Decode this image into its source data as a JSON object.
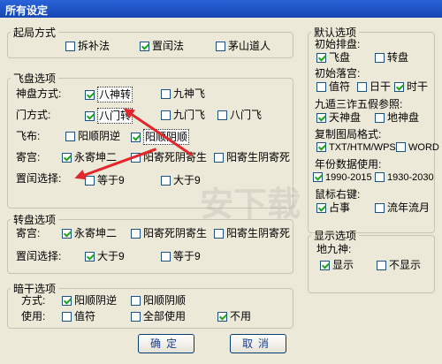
{
  "window": {
    "title": "所有设定"
  },
  "qiju": {
    "legend": "起局方式",
    "opts": [
      "拆补法",
      "置闰法",
      "茅山道人"
    ],
    "checked": [
      false,
      true,
      false
    ]
  },
  "feipan": {
    "legend": "飞盘选项",
    "shenpan": {
      "label": "神盘方式:",
      "opts": [
        "八神转",
        "九神飞"
      ],
      "checked": [
        true,
        false
      ]
    },
    "men": {
      "label": "门方式:",
      "opts": [
        "八门转",
        "九门飞",
        "八门飞"
      ],
      "checked": [
        true,
        false,
        false
      ]
    },
    "feibu": {
      "label": "飞布:",
      "opts": [
        "阳顺阴逆",
        "阳顺阴顺"
      ],
      "checked": [
        false,
        true
      ]
    },
    "jigong": {
      "label": "寄宫:",
      "opts": [
        "永寄坤二",
        "阳寄死阴寄生",
        "阳寄生阴寄死"
      ],
      "checked": [
        true,
        false,
        false
      ]
    },
    "zhirun": {
      "label": "置闰选择:",
      "opts": [
        "等于9",
        "大于9"
      ],
      "checked": [
        false,
        false
      ]
    }
  },
  "zhuanpan": {
    "legend": "转盘选项",
    "jigong": {
      "label": "寄宫:",
      "opts": [
        "永寄坤二",
        "阳寄死阴寄生",
        "阳寄生阴寄死"
      ],
      "checked": [
        true,
        false,
        false
      ]
    },
    "zhirun": {
      "label": "置闰选择:",
      "opts": [
        "大于9",
        "等于9"
      ],
      "checked": [
        true,
        false
      ]
    }
  },
  "angan": {
    "legend": "暗干选项",
    "fangshi": {
      "label": "方式:",
      "opts": [
        "阳顺阴逆",
        "阳顺阴顺"
      ],
      "checked": [
        true,
        false
      ]
    },
    "shiyong": {
      "label": "使用:",
      "opts": [
        "值符",
        "全部使用",
        "不用"
      ],
      "checked": [
        false,
        false,
        true
      ]
    }
  },
  "moren": {
    "legend": "默认选项",
    "paipan": {
      "label": "初始排盘:",
      "opts": [
        "飞盘",
        "转盘"
      ],
      "checked": [
        true,
        false
      ]
    },
    "luogong": {
      "label": "初始落宫:",
      "opts": [
        "值符",
        "日干",
        "时干"
      ],
      "checked": [
        false,
        false,
        true
      ]
    },
    "jiudun": {
      "label": "九遁三诈五假参照:",
      "opts": [
        "天神盘",
        "地神盘"
      ],
      "checked": [
        true,
        false
      ]
    },
    "fuzhi": {
      "label": "复制图局格式:",
      "opts": [
        "TXT/HTM/WPS",
        "WORD"
      ],
      "checked": [
        true,
        false
      ]
    },
    "nianfen": {
      "label": "年份数据使用:",
      "opts": [
        "1990-2015",
        "1930-2030"
      ],
      "checked": [
        true,
        false
      ]
    },
    "youjian": {
      "label": "鼠标右键:",
      "opts": [
        "占事",
        "流年流月"
      ],
      "checked": [
        true,
        false
      ]
    }
  },
  "xianshi": {
    "legend": "显示选项",
    "dijiushen": {
      "label": "地九神:",
      "opts": [
        "显示",
        "不显示"
      ],
      "checked": [
        true,
        false
      ]
    }
  },
  "buttons": {
    "ok": "确定",
    "cancel": "取消"
  },
  "colors": {
    "titlebar": "#1a52c8",
    "check": "#21a121",
    "arrow": "#e2262b",
    "dialog_bg": "#ece9d8"
  },
  "watermark": "安下载"
}
